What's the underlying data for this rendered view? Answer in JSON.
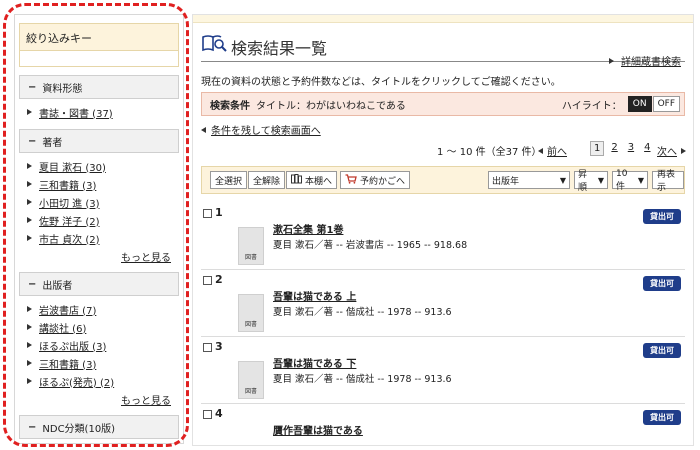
{
  "sidebar": {
    "header": "絞り込みキー",
    "facets": [
      {
        "title": "資料形態",
        "items": [
          "書誌・図書 (37)"
        ],
        "more": ""
      },
      {
        "title": "著者",
        "items": [
          "夏目 漱石 (30)",
          "三和書籍 (3)",
          "小田切 進 (3)",
          "佐野 洋子 (2)",
          "市古 貞次 (2)"
        ],
        "more": "もっと見る"
      },
      {
        "title": "出版者",
        "items": [
          "岩波書店 (7)",
          "講談社 (6)",
          "ほるぷ出版 (3)",
          "三和書籍 (3)",
          "ほるぷ(発売) (2)"
        ],
        "more": "もっと見る"
      },
      {
        "title": "NDC分類(10版)",
        "items": [],
        "more": ""
      }
    ]
  },
  "main": {
    "title": "検索結果一覧",
    "advanced_link": "詳細蔵書検索",
    "note": "現在の資料の状態と予約件数などは、タイトルをクリックしてご確認ください。",
    "condition_label": "検索条件",
    "condition_value": "タイトル：わがはいわねこである",
    "highlight_label": "ハイライト：",
    "on_label": "ON",
    "off_label": "OFF",
    "keep_link": "条件を残して検索画面へ",
    "pager": {
      "count": "1 ～ 10 件（全37 件）",
      "prev": "前へ",
      "pages": [
        "1",
        "2",
        "3",
        "4"
      ],
      "next": "次へ"
    },
    "toolbar": {
      "select_all": "全選択",
      "clear_all": "全解除",
      "shelf": "本棚へ",
      "cart": "予約かごへ",
      "sort_field": "出版年",
      "sort_order": "昇順",
      "per_page": "10件",
      "redisplay": "再表示"
    },
    "results": [
      {
        "num": "1",
        "title": "漱石全集 第1巻",
        "meta": "夏目 漱石／著 -- 岩波書店 -- 1965 -- 918.68",
        "status": "貸出可",
        "thumb_label": "図書"
      },
      {
        "num": "2",
        "title": "吾輩は猫である 上",
        "meta": "夏目 漱石／著 -- 偕成社 -- 1978 -- 913.6",
        "status": "貸出可",
        "thumb_label": "図書"
      },
      {
        "num": "3",
        "title": "吾輩は猫である 下",
        "meta": "夏目 漱石／著 -- 偕成社 -- 1978 -- 913.6",
        "status": "貸出可",
        "thumb_label": "図書"
      },
      {
        "num": "4",
        "title": "贋作吾輩は猫である",
        "meta": "",
        "status": "貸出可",
        "thumb_label": ""
      }
    ]
  },
  "colors": {
    "highlight_border": "#e02020",
    "status_badge": "#1f3d8a",
    "condition_bg": "#fbe8e0",
    "toolbar_bg": "#fdf3dc"
  }
}
